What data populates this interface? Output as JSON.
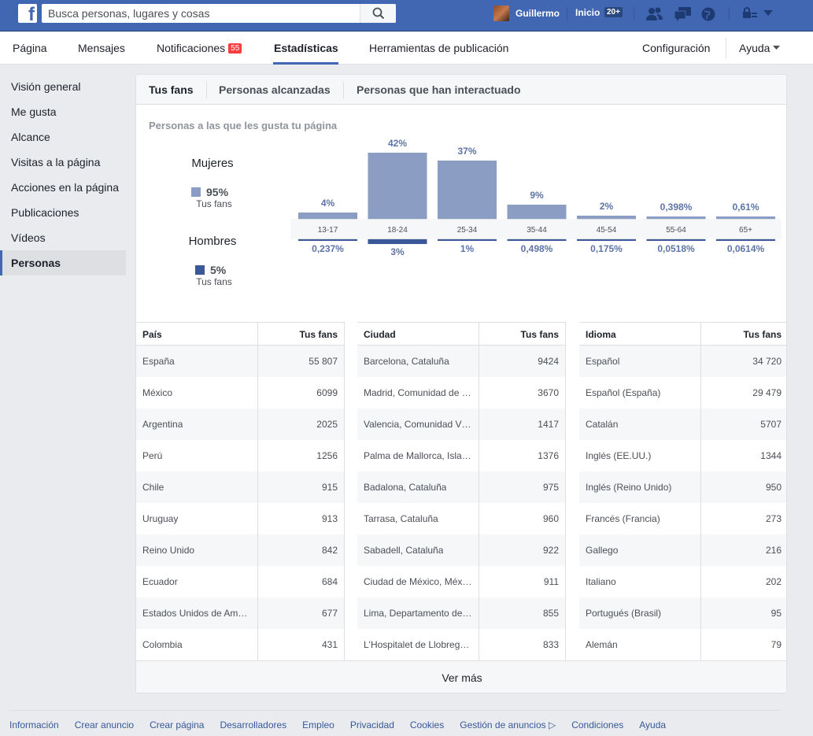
{
  "topbar": {
    "logo": "f",
    "search_placeholder": "Busca personas, lugares y cosas",
    "user_name": "Guillermo",
    "home_label": "Inicio",
    "home_badge": "20+"
  },
  "pagenav": {
    "items": [
      "Página",
      "Mensajes",
      "Notificaciones",
      "Estadísticas",
      "Herramientas de publicación"
    ],
    "notif_count": "55",
    "settings": "Configuración",
    "help": "Ayuda"
  },
  "sidebar": {
    "items": [
      "Visión general",
      "Me gusta",
      "Alcance",
      "Visitas a la página",
      "Acciones en la página",
      "Publicaciones",
      "Vídeos",
      "Personas"
    ]
  },
  "tabs": [
    "Tus fans",
    "Personas alcanzadas",
    "Personas que han interactuado"
  ],
  "section_title": "Personas a las que les gusta tu página",
  "gender": {
    "women_label": "Mujeres",
    "women_pct": "95%",
    "women_sub": "Tus fans",
    "men_label": "Hombres",
    "men_pct": "5%",
    "men_sub": "Tus fans",
    "women_color": "#8b9dc3",
    "men_color": "#3b5998"
  },
  "chart_data": {
    "type": "bar",
    "categories": [
      "13-17",
      "18-24",
      "25-34",
      "35-44",
      "45-54",
      "55-64",
      "65+"
    ],
    "series": [
      {
        "name": "Mujeres",
        "values": [
          4,
          42,
          37,
          9,
          2,
          0.398,
          0.61
        ],
        "labels": [
          "4%",
          "42%",
          "37%",
          "9%",
          "2%",
          "0,398%",
          "0,61%"
        ]
      },
      {
        "name": "Hombres",
        "values": [
          0.237,
          3,
          1,
          0.498,
          0.175,
          0.0518,
          0.0614
        ],
        "labels": [
          "0,237%",
          "3%",
          "1%",
          "0,498%",
          "0,175%",
          "0,0518%",
          "0,0614%"
        ]
      }
    ]
  },
  "tables": [
    {
      "header": "País",
      "value_header": "Tus fans",
      "rows": [
        [
          "España",
          "55 807"
        ],
        [
          "México",
          "6099"
        ],
        [
          "Argentina",
          "2025"
        ],
        [
          "Perú",
          "1256"
        ],
        [
          "Chile",
          "915"
        ],
        [
          "Uruguay",
          "913"
        ],
        [
          "Reino Unido",
          "842"
        ],
        [
          "Ecuador",
          "684"
        ],
        [
          "Estados Unidos de Am…",
          "677"
        ],
        [
          "Colombia",
          "431"
        ]
      ]
    },
    {
      "header": "Ciudad",
      "value_header": "Tus fans",
      "rows": [
        [
          "Barcelona, Cataluña",
          "9424"
        ],
        [
          "Madrid, Comunidad de …",
          "3670"
        ],
        [
          "Valencia, Comunidad V…",
          "1417"
        ],
        [
          "Palma de Mallorca, Isla…",
          "1376"
        ],
        [
          "Badalona, Cataluña",
          "975"
        ],
        [
          "Tarrasa, Cataluña",
          "960"
        ],
        [
          "Sabadell, Cataluña",
          "922"
        ],
        [
          "Ciudad de México, Méx…",
          "911"
        ],
        [
          "Lima, Departamento de…",
          "855"
        ],
        [
          "L'Hospitalet de Llobreg…",
          "833"
        ]
      ]
    },
    {
      "header": "Idioma",
      "value_header": "Tus fans",
      "rows": [
        [
          "Español",
          "34 720"
        ],
        [
          "Español (España)",
          "29 479"
        ],
        [
          "Catalán",
          "5707"
        ],
        [
          "Inglés (EE.UU.)",
          "1344"
        ],
        [
          "Inglés (Reino Unido)",
          "950"
        ],
        [
          "Francés (Francia)",
          "273"
        ],
        [
          "Gallego",
          "216"
        ],
        [
          "Italiano",
          "202"
        ],
        [
          "Portugués (Brasil)",
          "95"
        ],
        [
          "Alemán",
          "79"
        ]
      ]
    }
  ],
  "see_more": "Ver más",
  "footer": [
    "Información",
    "Crear anuncio",
    "Crear página",
    "Desarrolladores",
    "Empleo",
    "Privacidad",
    "Cookies",
    "Gestión de anuncios",
    "Condiciones",
    "Ayuda"
  ]
}
